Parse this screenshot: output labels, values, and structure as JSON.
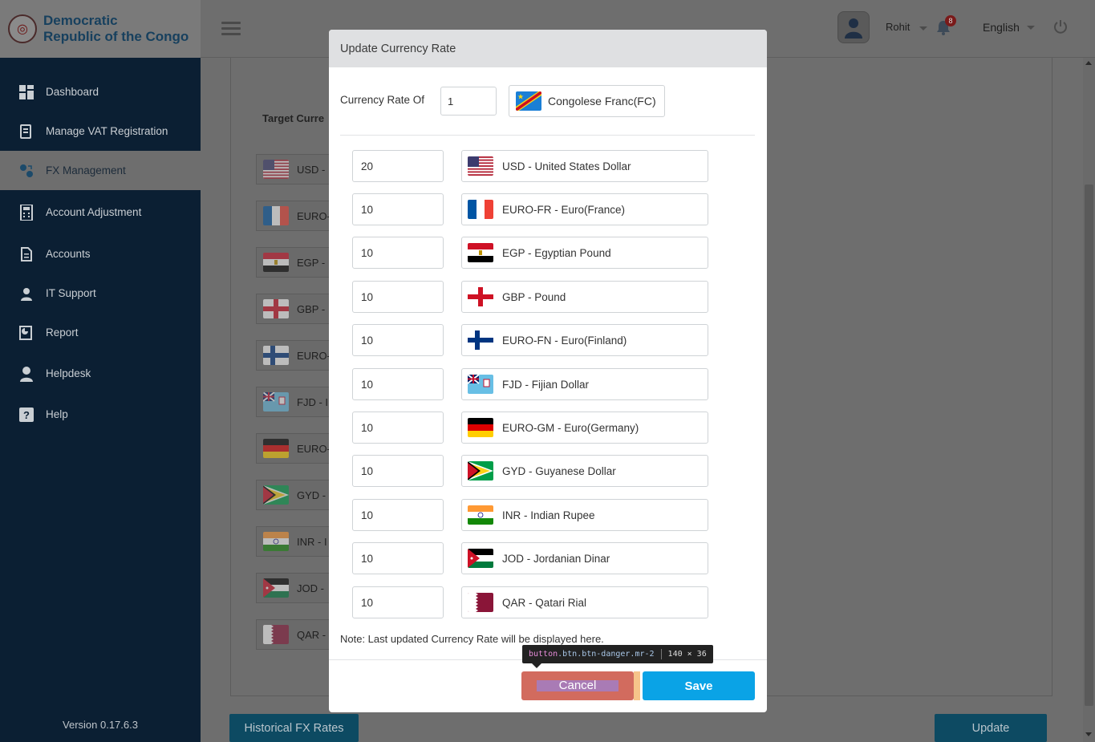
{
  "brand": {
    "name_line1": "Democratic",
    "name_line2": "Republic of the Congo"
  },
  "sidebar": {
    "items": [
      {
        "label": "Dashboard",
        "icon": "dashboard-icon"
      },
      {
        "label": "Manage VAT Registration",
        "icon": "vat-icon"
      },
      {
        "label": "FX Management",
        "icon": "fx-icon",
        "active": true
      },
      {
        "label": "Account Adjustment",
        "icon": "calculator-icon"
      },
      {
        "label": "Accounts",
        "icon": "document-icon"
      },
      {
        "label": "IT Support",
        "icon": "support-agent-icon"
      },
      {
        "label": "Report",
        "icon": "report-icon"
      },
      {
        "label": "Helpdesk",
        "icon": "helpdesk-icon"
      },
      {
        "label": "Help",
        "icon": "help-icon"
      }
    ],
    "version": "Version 0.17.6.3"
  },
  "topbar": {
    "username": "Rohit",
    "notification_count": "8",
    "language": "English"
  },
  "background": {
    "target_label": "Target Curre",
    "rows": [
      "USD -",
      "EURO-",
      "EGP -",
      "GBP -",
      "EURO-",
      "FJD - I",
      "EURO-",
      "GYD -",
      "INR - I",
      "JOD -",
      "QAR -"
    ],
    "historical_button": "Historical FX Rates",
    "update_button": "Update"
  },
  "modal": {
    "title": "Update Currency Rate",
    "rate_of_label": "Currency Rate Of",
    "rate_of_value": "1",
    "base_currency": "Congolese Franc(FC)",
    "rates": [
      {
        "value": "20",
        "currency": "USD - United States Dollar",
        "flag": "us"
      },
      {
        "value": "10",
        "currency": "EURO-FR - Euro(France)",
        "flag": "fr"
      },
      {
        "value": "10",
        "currency": "EGP - Egyptian Pound",
        "flag": "eg"
      },
      {
        "value": "10",
        "currency": "GBP - Pound",
        "flag": "en"
      },
      {
        "value": "10",
        "currency": "EURO-FN - Euro(Finland)",
        "flag": "fi"
      },
      {
        "value": "10",
        "currency": "FJD - Fijian Dollar",
        "flag": "fj"
      },
      {
        "value": "10",
        "currency": "EURO-GM - Euro(Germany)",
        "flag": "de"
      },
      {
        "value": "10",
        "currency": "GYD - Guyanese Dollar",
        "flag": "gy"
      },
      {
        "value": "10",
        "currency": "INR - Indian Rupee",
        "flag": "in"
      },
      {
        "value": "10",
        "currency": "JOD - Jordanian Dinar",
        "flag": "jo"
      },
      {
        "value": "10",
        "currency": "QAR - Qatari Rial",
        "flag": "qa"
      }
    ],
    "note": "Note:  Last updated Currency Rate will be displayed here.",
    "cancel_label": "Cancel",
    "save_label": "Save"
  },
  "devtools_tooltip": {
    "selector_tag": "button",
    "selector_rest": ".btn.btn-danger.mr-2",
    "size": "140 × 36"
  }
}
